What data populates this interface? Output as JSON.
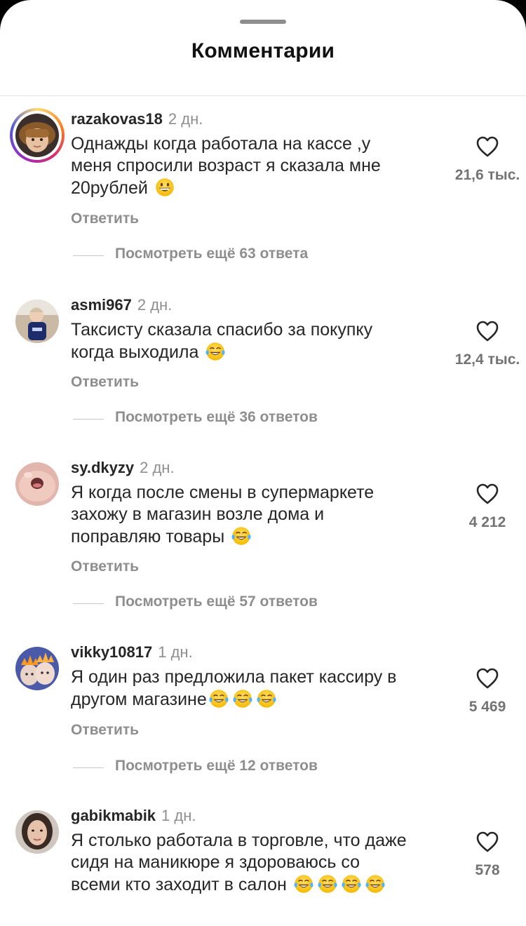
{
  "sheet": {
    "title": "Комментарии"
  },
  "comments": [
    {
      "username": "razakovas18",
      "time": "2 дн.",
      "text_lines": [
        "Однажды когда работала на кассе ,у",
        "меня спросили возраст я сказала мне",
        "20рублей"
      ],
      "emoji": "grinning-face",
      "reply_label": "Ответить",
      "view_replies": "Посмотреть ещё 63 ответа",
      "likes": "21,6 тыс.",
      "avatar": {
        "icon": "avatar-child-in-hat",
        "has_story": true
      }
    },
    {
      "username": "asmi967",
      "time": "2 дн.",
      "text_lines": [
        "Таксисту сказала спасибо за покупку",
        "когда выходила"
      ],
      "emoji": "tears-of-joy",
      "reply_label": "Ответить",
      "view_replies": "Посмотреть ещё 36 ответов",
      "likes": "12,4 тыс.",
      "avatar": {
        "icon": "avatar-toddler",
        "has_story": false
      }
    },
    {
      "username": "sy.dkyzy",
      "time": "2 дн.",
      "text_lines": [
        "Я когда после смены в супермаркете",
        "захожу в магазин возле дома и",
        "поправляю товары"
      ],
      "emoji": "tears-of-joy",
      "reply_label": "Ответить",
      "view_replies": "Посмотреть ещё 57 ответов",
      "likes": "4 212",
      "avatar": {
        "icon": "avatar-pink-face",
        "has_story": false
      }
    },
    {
      "username": "vikky10817",
      "time": "1 дн.",
      "text_lines": [
        "Я один раз предложила пакет кассиру в",
        "другом магазине"
      ],
      "emoji": "tears-of-joy",
      "emoji_count": 3,
      "reply_label": "Ответить",
      "view_replies": "Посмотреть ещё 12 ответов",
      "likes": "5 469",
      "avatar": {
        "icon": "avatar-kids-filter",
        "has_story": false
      }
    },
    {
      "username": "gabikmabik",
      "time": "1 дн.",
      "text_lines": [
        "Я столько работала в торговле, что даже",
        "сидя на маникюре я здороваюсь со",
        "всеми кто заходит в салон"
      ],
      "emoji": "tears-of-joy",
      "emoji_count": 4,
      "likes": "578",
      "avatar": {
        "icon": "avatar-woman-portrait",
        "has_story": false
      }
    }
  ],
  "icons": {
    "like": "heart-outline-icon"
  },
  "colors": {
    "text": "#262626",
    "muted": "#8e8e8e",
    "like_count": "#737373",
    "story_ring": "#d62976"
  }
}
